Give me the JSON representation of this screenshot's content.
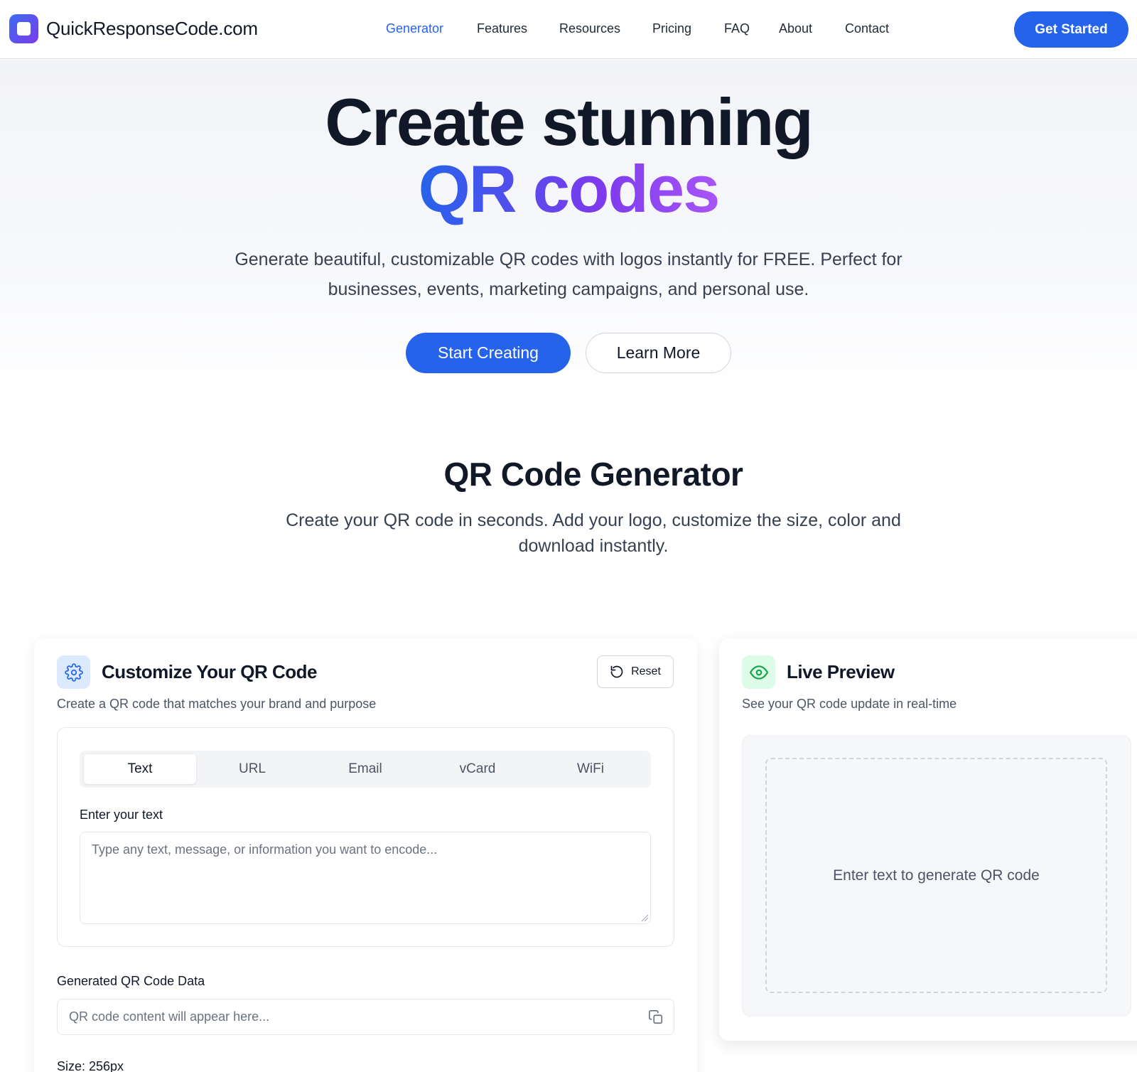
{
  "brand": {
    "name": "QuickResponseCode.com"
  },
  "nav": {
    "items": [
      {
        "label": "Generator",
        "active": true
      },
      {
        "label": "Features",
        "active": false
      },
      {
        "label": "Resources",
        "active": false
      },
      {
        "label": "Pricing",
        "active": false
      },
      {
        "label": "FAQ",
        "active": false
      },
      {
        "label": "About",
        "active": false
      },
      {
        "label": "Contact",
        "active": false
      }
    ],
    "cta_label": "Get Started"
  },
  "hero": {
    "title_line1": "Create stunning",
    "title_line2": "QR codes",
    "subtitle": "Generate beautiful, customizable QR codes with logos instantly for FREE. Perfect for businesses, events, marketing campaigns, and personal use.",
    "primary_button": "Start Creating",
    "secondary_button": "Learn More"
  },
  "generator": {
    "title": "QR Code Generator",
    "subtitle": "Create your QR code in seconds. Add your logo, customize the size, color and download instantly."
  },
  "customize": {
    "icon": "gear-icon",
    "title": "Customize Your QR Code",
    "description": "Create a QR code that matches your brand and purpose",
    "reset_label": "Reset",
    "reset_icon": "reset-icon",
    "tabs": [
      {
        "label": "Text",
        "active": true
      },
      {
        "label": "URL",
        "active": false
      },
      {
        "label": "Email",
        "active": false
      },
      {
        "label": "vCard",
        "active": false
      },
      {
        "label": "WiFi",
        "active": false
      }
    ],
    "text_label": "Enter your text",
    "text_value": "",
    "text_placeholder": "Type any text, message, or information you want to encode...",
    "data_label": "Generated QR Code Data",
    "data_value": "",
    "data_placeholder": "QR code content will appear here...",
    "copy_icon": "copy-icon",
    "size_label": "Size: 256px"
  },
  "preview": {
    "icon": "eye-icon",
    "title": "Live Preview",
    "description": "See your QR code update in real-time",
    "empty_message": "Enter text to generate QR code"
  },
  "colors": {
    "accent": "#2563eb",
    "gradient_end": "#7c3aed",
    "preview_icon": "#16a34a"
  }
}
